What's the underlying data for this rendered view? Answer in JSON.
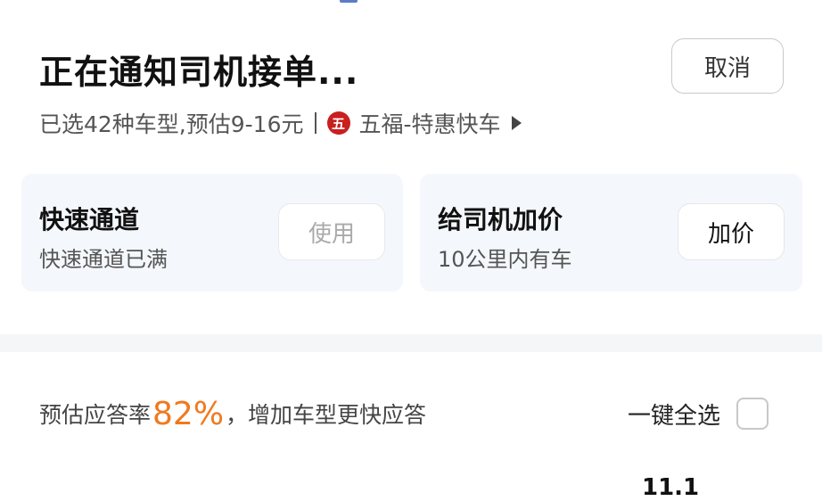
{
  "header": {
    "title": "正在通知司机接单...",
    "cancel_label": "取消",
    "summary": "已选42种车型,预估9-16元",
    "brand_icon_char": "五",
    "brand_name": "五福-特惠快车"
  },
  "cards": {
    "fast": {
      "title": "快速通道",
      "subtitle": "快速通道已满",
      "button": "使用"
    },
    "raise": {
      "title": "给司机加价",
      "subtitle": "10公里内有车",
      "button": "加价"
    }
  },
  "response": {
    "prefix": "预估应答率",
    "rate": "82%",
    "suffix": "，增加车型更快应答",
    "select_all_label": "一键全选",
    "select_all_checked": false
  },
  "partial_text": "11.1",
  "colors": {
    "accent_orange": "#f0791e",
    "brand_red": "#c81f1f",
    "card_bg": "#f4f7fb"
  }
}
